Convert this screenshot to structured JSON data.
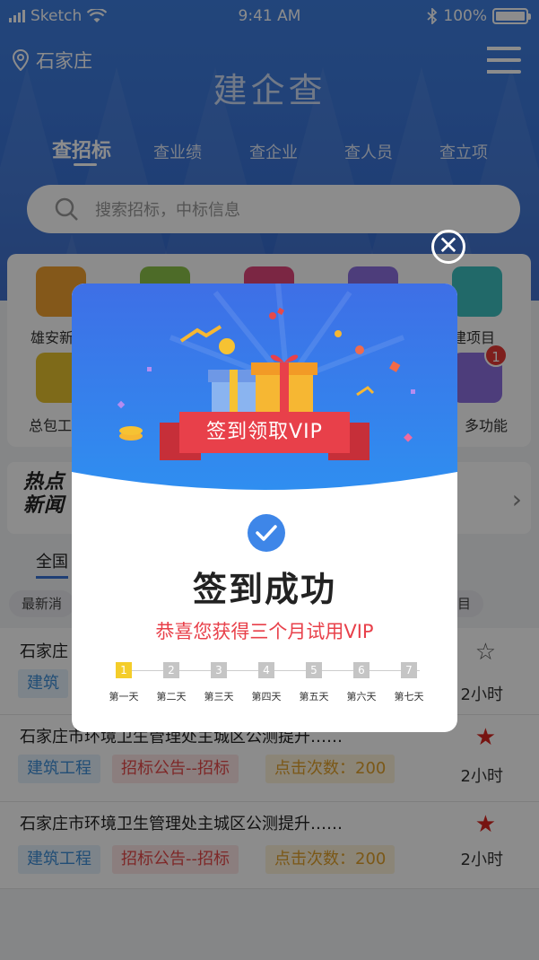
{
  "status_bar": {
    "carrier": "Sketch",
    "time": "9:41 AM",
    "battery": "100%"
  },
  "header": {
    "location": "石家庄",
    "brand": "建企查"
  },
  "tabs": [
    {
      "label": "查招标",
      "active": true
    },
    {
      "label": "查业绩"
    },
    {
      "label": "查企业"
    },
    {
      "label": "查人员"
    },
    {
      "label": "查立项"
    }
  ],
  "search": {
    "placeholder": "搜索招标，中标信息"
  },
  "grid": {
    "label_1": "雄安新",
    "label_2": "总包工",
    "label_3": "建项目",
    "label_4": "多功能",
    "badge": "1"
  },
  "news": {
    "tag_line1": "热点",
    "tag_line2": "新闻"
  },
  "list": {
    "region_tab": "全国",
    "filter_left": "最新消",
    "filter_right": "目",
    "items": [
      {
        "title": "石家庄",
        "tag1": "建筑",
        "time": "2小时"
      },
      {
        "title": "石家庄市环境卫生管理处主城区公测提升……",
        "tag1": "建筑工程",
        "tag2": "招标公告--招标",
        "tag3": "点击次数：200",
        "time": "2小时"
      },
      {
        "title": "石家庄市环境卫生管理处主城区公测提升……",
        "tag1": "建筑工程",
        "tag2": "招标公告--招标",
        "tag3": "点击次数：200",
        "time": "2小时"
      }
    ]
  },
  "modal": {
    "ribbon": "签到领取VIP",
    "title": "签到成功",
    "subtitle": "恭喜您获得三个月试用VIP",
    "current_day": 1,
    "days": [
      {
        "n": "1",
        "label": "第一天"
      },
      {
        "n": "2",
        "label": "第二天"
      },
      {
        "n": "3",
        "label": "第三天"
      },
      {
        "n": "4",
        "label": "第四天"
      },
      {
        "n": "5",
        "label": "第五天"
      },
      {
        "n": "6",
        "label": "第六天"
      },
      {
        "n": "7",
        "label": "第七天"
      }
    ]
  },
  "colors": {
    "primary": "#3a73d6",
    "accent_red": "#e8404a",
    "day_active": "#f4cd2a"
  }
}
